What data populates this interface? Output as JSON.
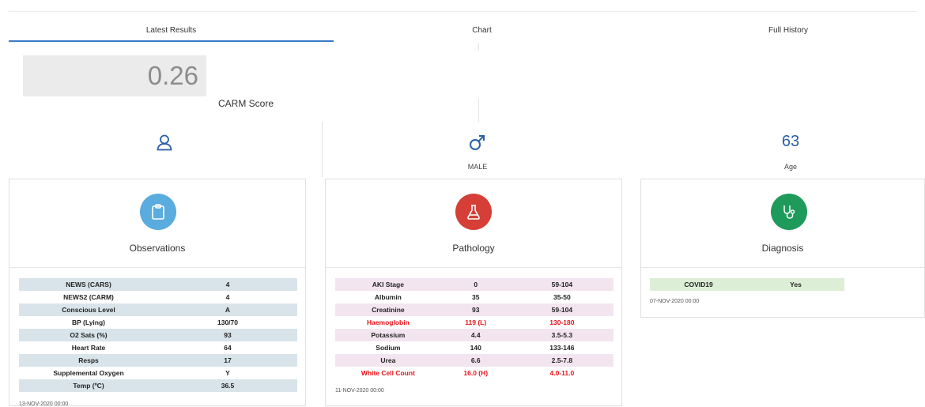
{
  "tabs": [
    {
      "label": "Latest Results",
      "active": true
    },
    {
      "label": "Chart",
      "active": false
    },
    {
      "label": "Full History",
      "active": false
    }
  ],
  "score": {
    "value": "0.26",
    "label": "CARM Score"
  },
  "demographics": {
    "person_icon": "person-icon",
    "gender_icon": "male-symbol-icon",
    "gender_label": "MALE",
    "age_value": "63",
    "age_label": "Age"
  },
  "cards": {
    "observations": {
      "title": "Observations",
      "icon": "clipboard-icon",
      "color": "#5aabde",
      "rows": [
        [
          "NEWS (CARS)",
          "4"
        ],
        [
          "NEWS2 (CARM)",
          "4"
        ],
        [
          "Conscious Level",
          "A"
        ],
        [
          "BP (Lying)",
          "130/70"
        ],
        [
          "O2 Sats (%)",
          "93"
        ],
        [
          "Heart Rate",
          "64"
        ],
        [
          "Resps",
          "17"
        ],
        [
          "Supplemental Oxygen",
          "Y"
        ],
        [
          "Temp (ºC)",
          "36.5"
        ]
      ],
      "timestamp": "13-NOV-2020 00:00",
      "stripe_color": "#d9e4ea"
    },
    "pathology": {
      "title": "Pathology",
      "icon": "flask-icon",
      "color": "#d53f37",
      "rows": [
        {
          "name": "AKI Stage",
          "value": "0",
          "range": "59-104",
          "abnormal": false
        },
        {
          "name": "Albumin",
          "value": "35",
          "range": "35-50",
          "abnormal": false
        },
        {
          "name": "Creatinine",
          "value": "93",
          "range": "59-104",
          "abnormal": false
        },
        {
          "name": "Haemoglobin",
          "value": "119 (L)",
          "range": "130-180",
          "abnormal": true
        },
        {
          "name": "Potassium",
          "value": "4.4",
          "range": "3.5-5.3",
          "abnormal": false
        },
        {
          "name": "Sodium",
          "value": "140",
          "range": "133-146",
          "abnormal": false
        },
        {
          "name": "Urea",
          "value": "6.6",
          "range": "2.5-7.8",
          "abnormal": false
        },
        {
          "name": "White Cell Count",
          "value": "16.0 (H)",
          "range": "4.0-11.0",
          "abnormal": true
        }
      ],
      "timestamp": "11-NOV-2020 00:00",
      "stripe_color": "#f3e5f0",
      "abnormal_color": "#e8141c"
    },
    "diagnosis": {
      "title": "Diagnosis",
      "icon": "stethoscope-icon",
      "color": "#1e9a5a",
      "rows": [
        [
          "COVID19",
          "Yes"
        ]
      ],
      "timestamp": "07-NOV-2020 00:00",
      "stripe_color": "#dcefd6"
    }
  }
}
